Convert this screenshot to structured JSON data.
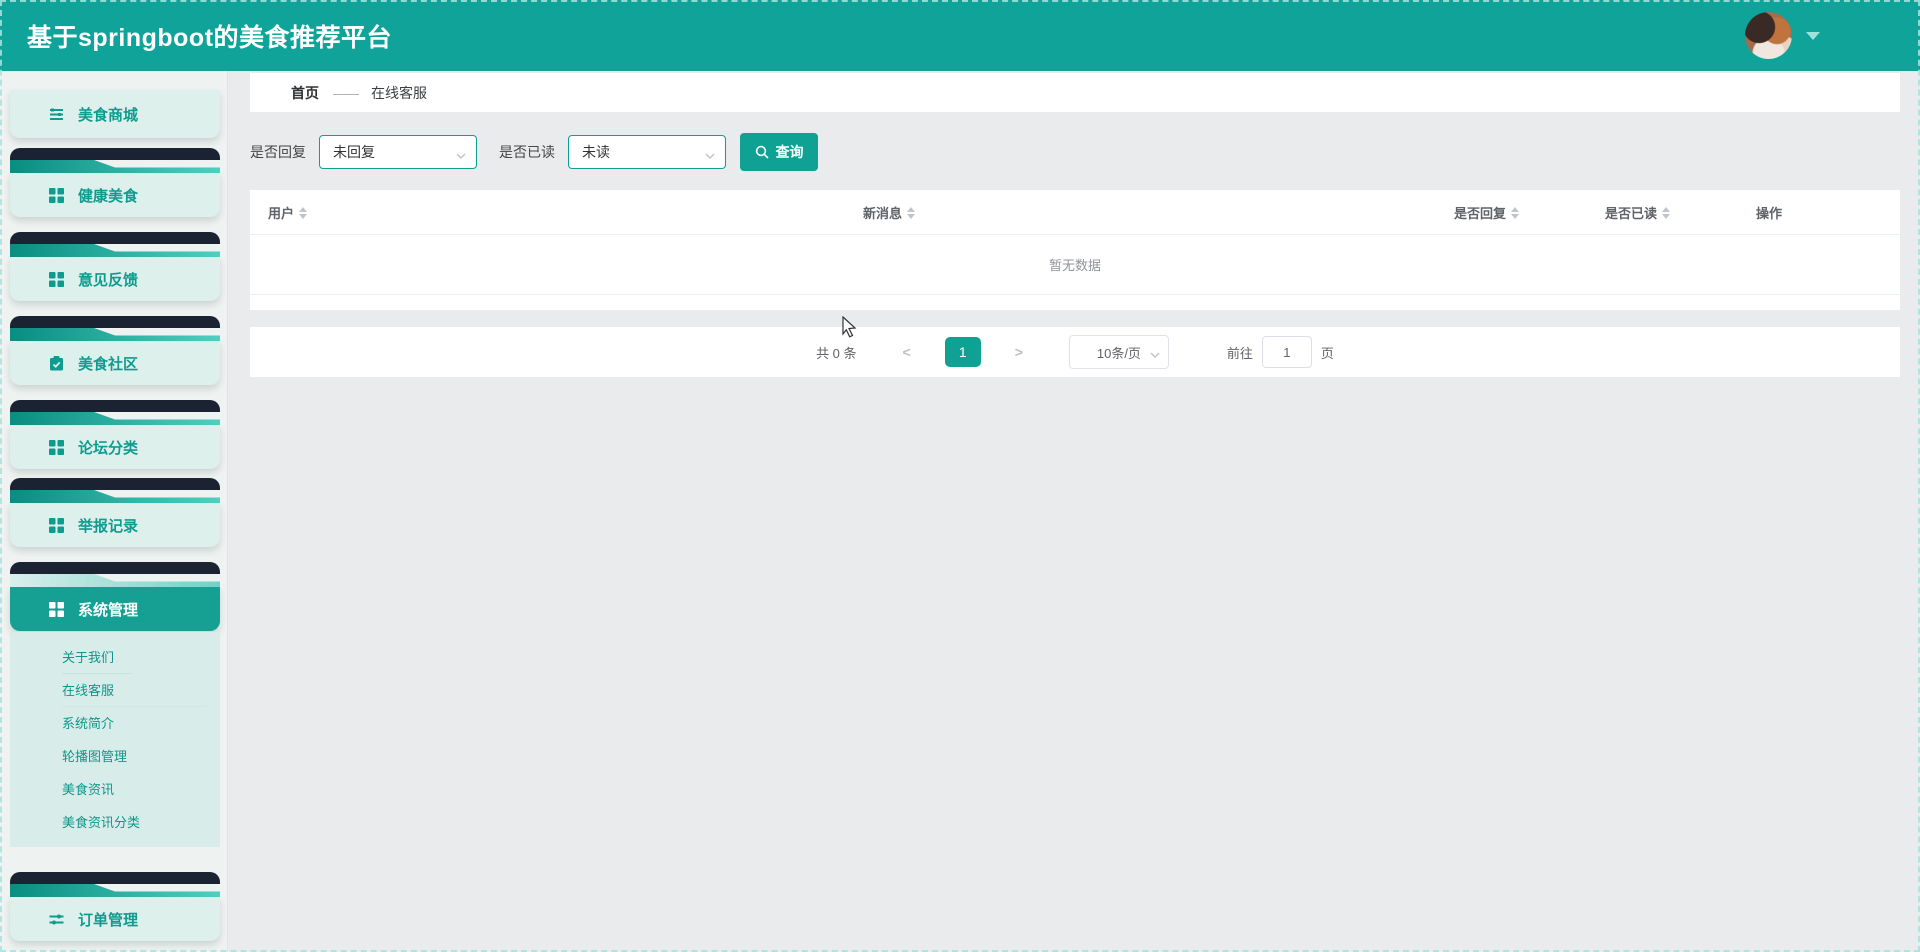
{
  "app": {
    "title": "基于springboot的美食推荐平台"
  },
  "sidebar": {
    "items": [
      {
        "label": "美食商城",
        "icon": "sliders-icon"
      },
      {
        "label": "健康美食",
        "icon": "grid-icon"
      },
      {
        "label": "意见反馈",
        "icon": "grid-icon"
      },
      {
        "label": "美食社区",
        "icon": "clipboard-check-icon"
      },
      {
        "label": "论坛分类",
        "icon": "grid-icon"
      },
      {
        "label": "举报记录",
        "icon": "grid-icon"
      },
      {
        "label": "系统管理",
        "icon": "grid-icon",
        "active": true
      },
      {
        "label": "订单管理",
        "icon": "sliders-icon"
      }
    ],
    "submenu": [
      {
        "label": "关于我们"
      },
      {
        "label": "在线客服"
      },
      {
        "label": "系统简介"
      },
      {
        "label": "轮播图管理"
      },
      {
        "label": "美食资讯"
      },
      {
        "label": "美食资讯分类"
      }
    ]
  },
  "breadcrumb": {
    "home": "首页",
    "separator": "——",
    "current": "在线客服"
  },
  "filters": {
    "reply": {
      "label": "是否回复",
      "value": "未回复"
    },
    "read": {
      "label": "是否已读",
      "value": "未读"
    },
    "search_label": "查询"
  },
  "table": {
    "columns": [
      {
        "label": "用户",
        "sortable": true
      },
      {
        "label": "新消息",
        "sortable": true
      },
      {
        "label": "是否回复",
        "sortable": true
      },
      {
        "label": "是否已读",
        "sortable": true
      },
      {
        "label": "操作",
        "sortable": false
      }
    ],
    "empty_text": "暂无数据"
  },
  "pagination": {
    "total": "共 0 条",
    "prev": "<",
    "current_page": "1",
    "next": ">",
    "page_size": "10条/页",
    "goto_label": "前往",
    "goto_value": "1",
    "goto_suffix": "页"
  },
  "colors": {
    "header_bg": "#10A39A",
    "accent": "#0FA194",
    "card_dark_strip": "#1B2231",
    "card_bg": "#DEF0EC",
    "active_card_bg": "#16A093",
    "submenu_bg": "#D8EDE9"
  }
}
